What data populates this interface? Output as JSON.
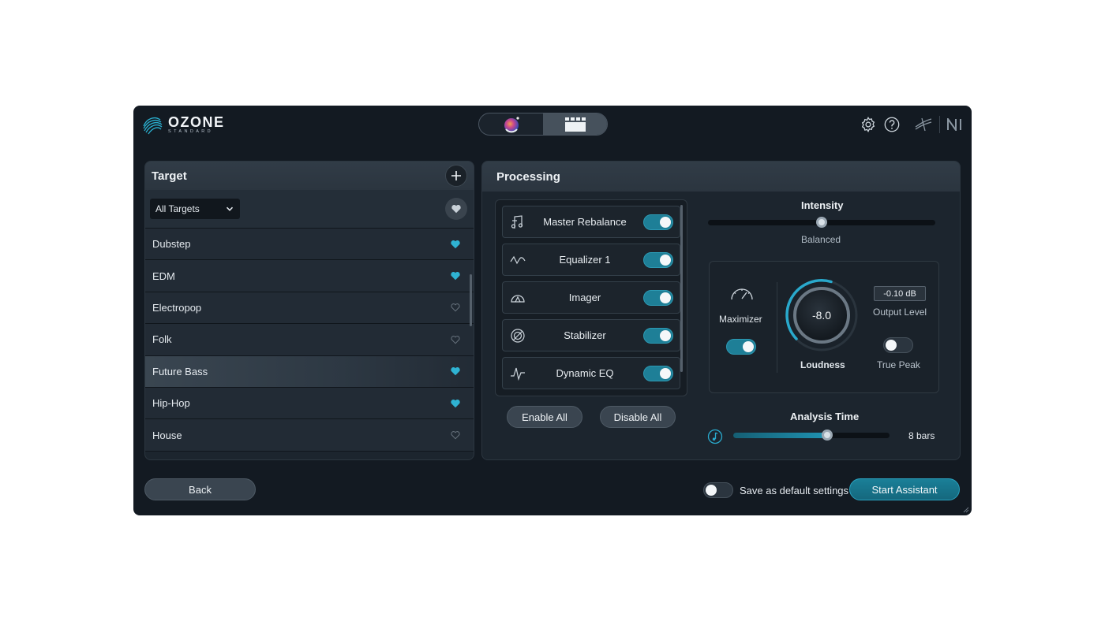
{
  "app": {
    "logo_main": "OZONE",
    "logo_sub": "STANDARD",
    "mode_switch": {
      "icons": [
        "assistant-orb-icon",
        "modules-grid-icon"
      ]
    },
    "header_icons": [
      "gear-icon",
      "help-icon",
      "izotope-logo-icon",
      "ni-logo-icon"
    ]
  },
  "target": {
    "title": "Target",
    "filter": {
      "selected": "All Targets"
    },
    "items": [
      {
        "label": "Dubstep",
        "favorite": true
      },
      {
        "label": "EDM",
        "favorite": true
      },
      {
        "label": "Electropop",
        "favorite": false
      },
      {
        "label": "Folk",
        "favorite": false
      },
      {
        "label": "Future Bass",
        "favorite": true,
        "selected": true
      },
      {
        "label": "Hip-Hop",
        "favorite": true
      },
      {
        "label": "House",
        "favorite": false
      }
    ]
  },
  "processing": {
    "title": "Processing",
    "modules": [
      {
        "label": "Master Rebalance",
        "icon": "master-rebalance-icon",
        "enabled": true
      },
      {
        "label": "Equalizer 1",
        "icon": "equalizer-icon",
        "enabled": true
      },
      {
        "label": "Imager",
        "icon": "imager-icon",
        "enabled": true
      },
      {
        "label": "Stabilizer",
        "icon": "stabilizer-icon",
        "enabled": true
      },
      {
        "label": "Dynamic EQ",
        "icon": "dynamic-eq-icon",
        "enabled": true
      }
    ],
    "enable_all_label": "Enable All",
    "disable_all_label": "Disable All",
    "intensity": {
      "label": "Intensity",
      "value_label": "Balanced",
      "position_fraction": 0.5
    },
    "maximizer": {
      "label": "Maximizer",
      "enabled": true,
      "loudness_value": "-8.0",
      "loudness_label": "Loudness",
      "output_level_value": "-0.10 dB",
      "output_level_label": "Output Level",
      "true_peak_label": "True Peak",
      "true_peak_enabled": false
    },
    "analysis_time": {
      "label": "Analysis Time",
      "value_label": "8 bars",
      "position_fraction": 0.6
    }
  },
  "footer": {
    "back_label": "Back",
    "save_default_label": "Save as default settings",
    "save_default_enabled": false,
    "start_label": "Start Assistant"
  },
  "colors": {
    "accent": "#1e7f97",
    "background": "#131a22",
    "favorite": "#2fb3d3"
  }
}
